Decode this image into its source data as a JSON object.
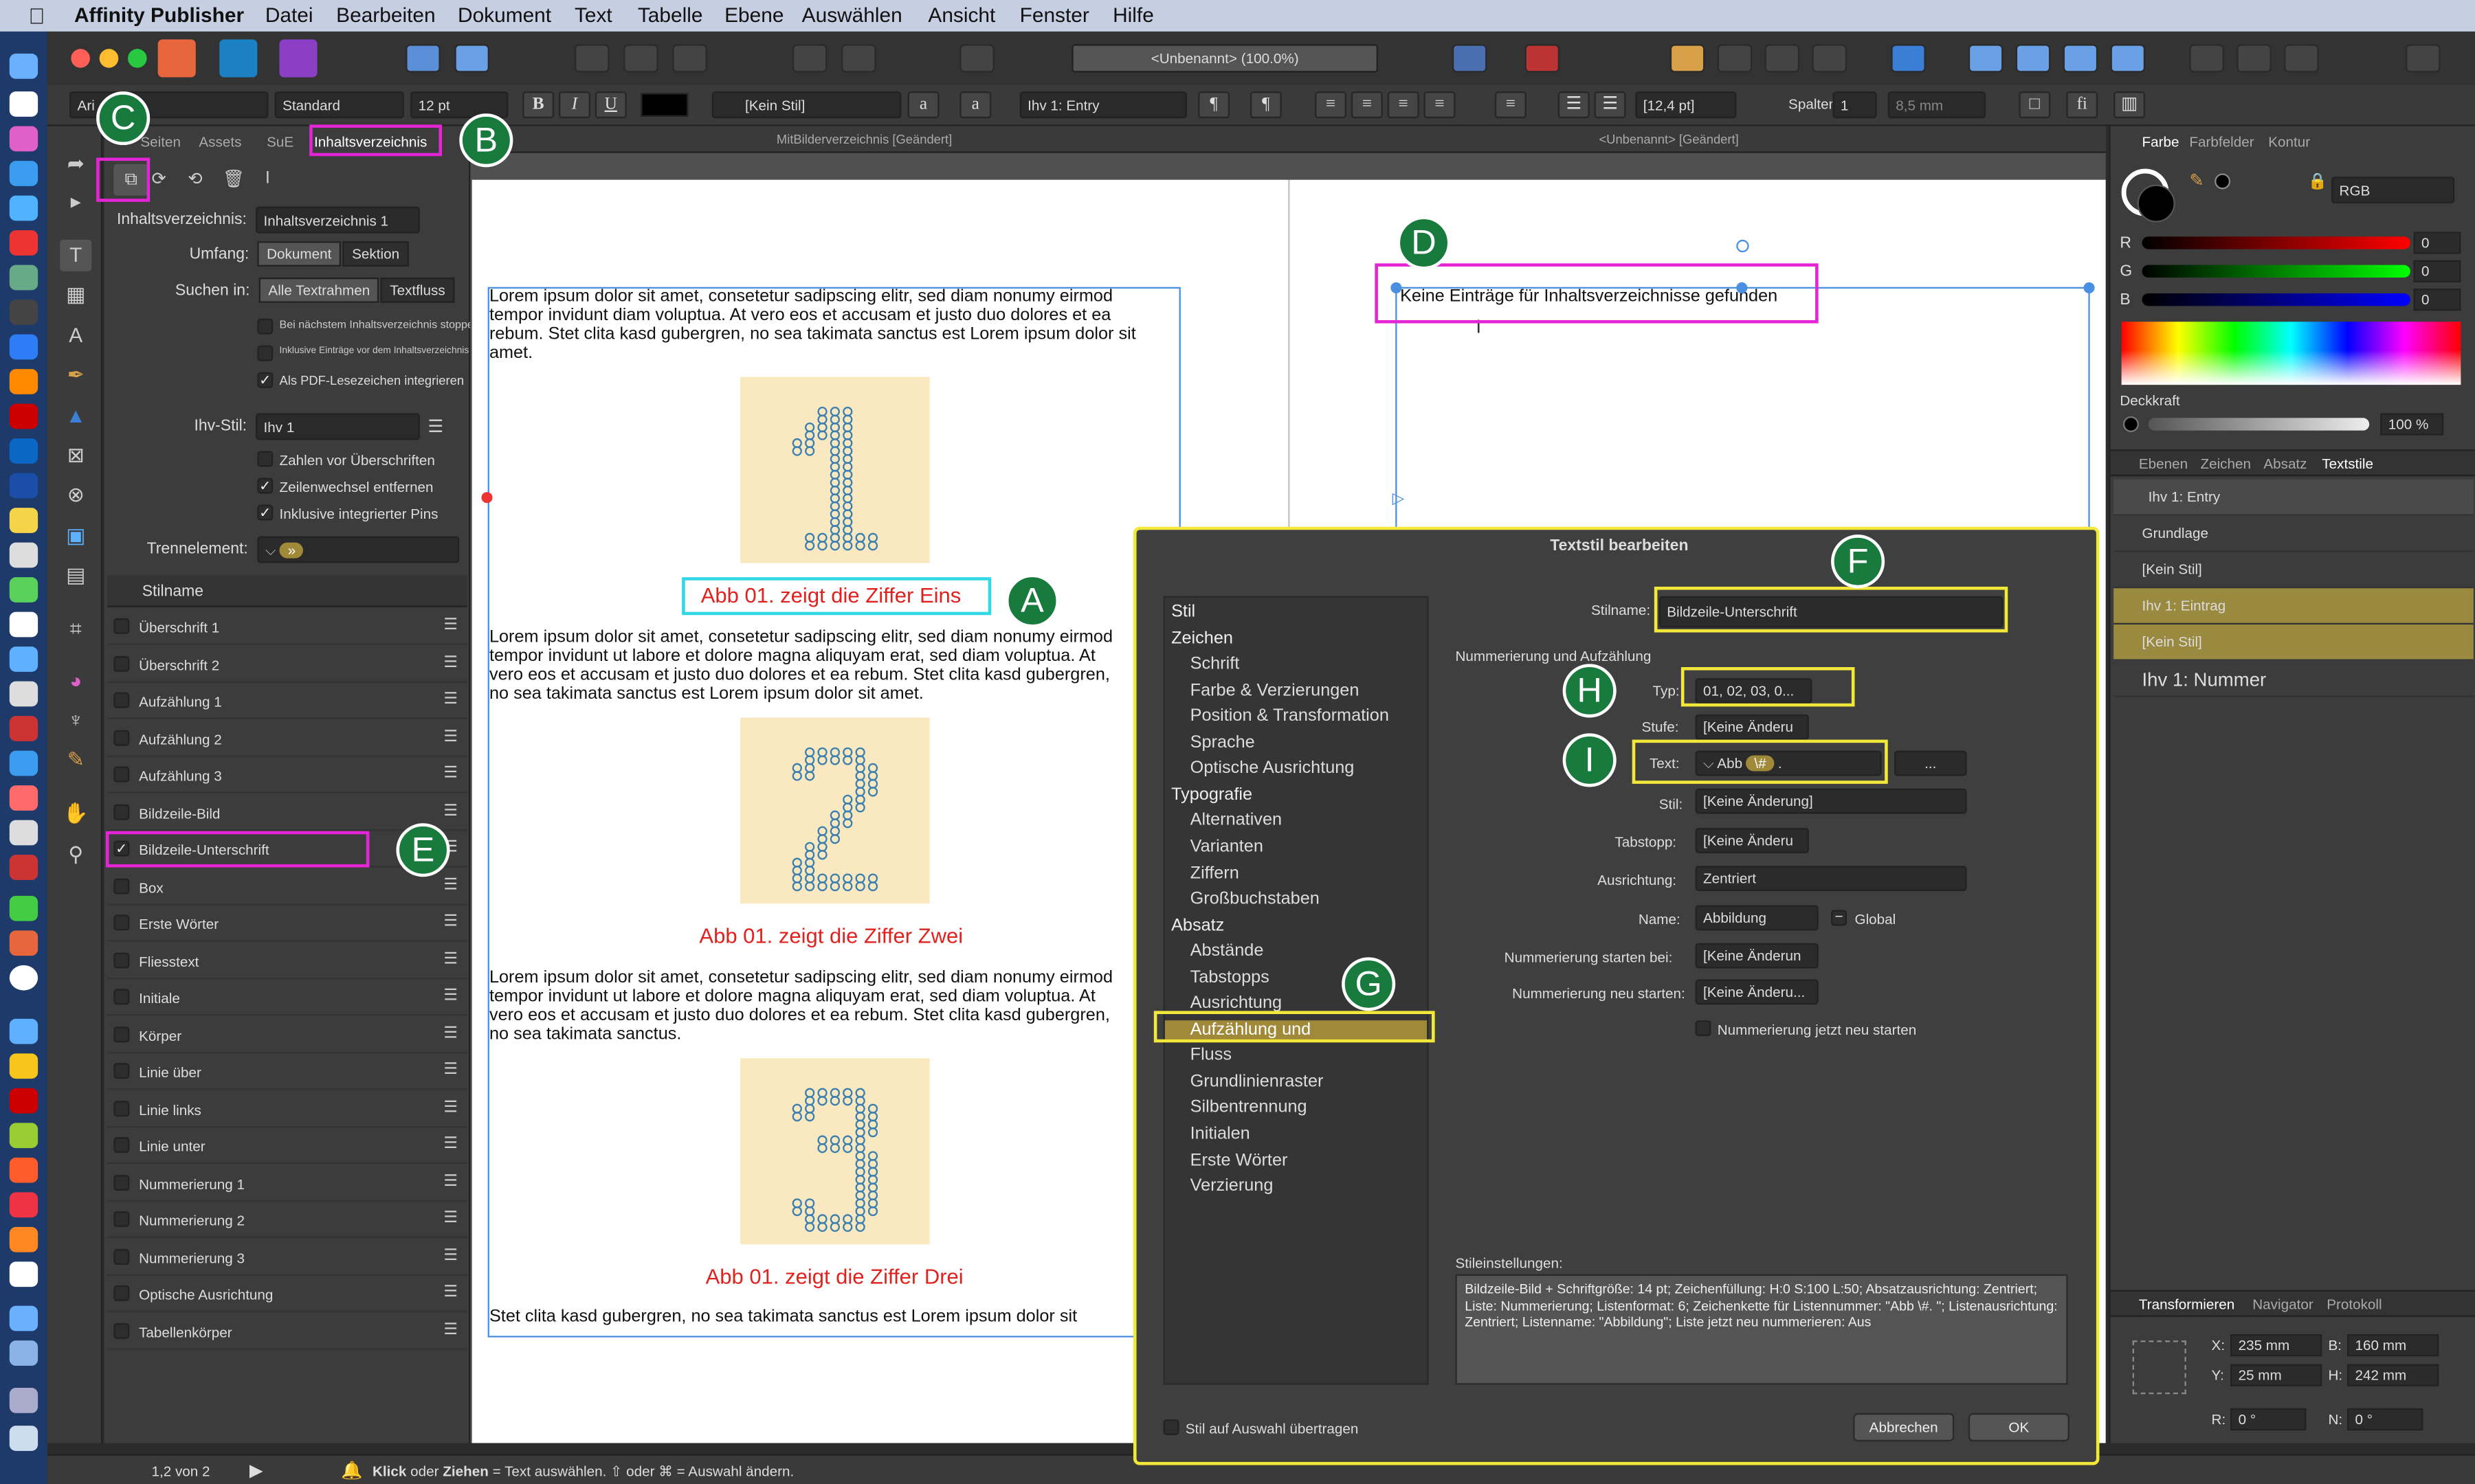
{
  "menubar": {
    "app": "Affinity Publisher",
    "items": [
      "Datei",
      "Bearbeiten",
      "Dokument",
      "Text",
      "Tabelle",
      "Ebene",
      "Auswählen",
      "Ansicht",
      "Fenster",
      "Hilfe"
    ]
  },
  "titlebar": {
    "doc_title": "<Unbenannt> (100.0%)"
  },
  "context_toolbar": {
    "font": "Ari",
    "style": "Standard",
    "size": "12 pt",
    "char_style": "[Kein Stil]",
    "para_style": "Ihv 1: Entry",
    "leading": "[12,4 pt]",
    "columns_label": "Spalten:",
    "columns": "1",
    "gutter": "8,5 mm",
    "bold": "B",
    "italic": "I",
    "underline": "U"
  },
  "left_panel": {
    "tabs": [
      "Seiten",
      "Assets",
      "SuE",
      "Inhaltsverzeichnis"
    ],
    "toc_label": "Inhaltsverzeichnis:",
    "toc_value": "Inhaltsverzeichnis 1",
    "scope_label": "Umfang:",
    "scope_options": [
      "Dokument",
      "Sektion"
    ],
    "search_label": "Suchen in:",
    "search_options": [
      "Alle Textrahmen",
      "Textfluss"
    ],
    "opt1": "Bei nächstem Inhaltsverzeichnis stoppen",
    "opt2": "Inklusive Einträge vor dem Inhaltsverzeichnis",
    "opt3": "Als PDF-Lesezeichen integrieren",
    "ihv_label": "Ihv-Stil:",
    "ihv_value": "Ihv 1",
    "opt4": "Zahlen vor Überschriften",
    "opt5": "Zeilenwechsel entfernen",
    "opt6": "Inklusive integrierter Pins",
    "sep_label": "Trennelement:",
    "sep_value": "»",
    "list_header": "Stilname",
    "styles": [
      "Überschrift 1",
      "Überschrift 2",
      "Aufzählung 1",
      "Aufzählung 2",
      "Aufzählung 3",
      "Bildzeile-Bild",
      "Bildzeile-Unterschrift",
      "Box",
      "Erste Wörter",
      "Fliesstext",
      "Initiale",
      "Körper",
      "Linie über",
      "Linie links",
      "Linie unter",
      "Nummerierung 1",
      "Nummerierung 2",
      "Nummerierung 3",
      "Optische Ausrichtung",
      "Tabellenkörper"
    ]
  },
  "canvas": {
    "tab1": "MitBilderverzeichnis [Geändert]",
    "tab2": "<Unbenannt> [Geändert]",
    "lorem1": "Lorem ipsum dolor sit amet, consetetur sadipscing elitr, sed diam nonumy eirmod tempor invidunt  diam voluptua. At vero eos et accusam et justo duo dolores et ea rebum. Stet clita kasd gubergren, no sea takimata sanctus est Lorem ipsum dolor sit amet.",
    "lorem2": "Lorem ipsum dolor sit amet, consetetur sadipscing elitr, sed diam nonumy eirmod tempor invidunt ut labore et dolore magna aliquyam erat, sed diam voluptua. At vero eos et accusam et justo duo dolores et ea rebum. Stet clita kasd gubergren, no sea takimata sanctus est Lorem ipsum dolor sit amet.",
    "lorem3": "Lorem ipsum dolor sit amet, consetetur sadipscing elitr, sed diam nonumy eirmod tempor invidunt ut labore et dolore magna aliquyam erat, sed diam voluptua. At vero eos et accusam et justo duo dolores et ea rebum. Stet clita kasd gubergren, no sea takimata sanctus.",
    "lorem4": "Stet clita kasd gubergren, no sea takimata sanctus est Lorem ipsum dolor sit",
    "caption1": "Abb 01. zeigt die Ziffer Eins",
    "caption2": "Abb 01. zeigt die Ziffer Zwei",
    "caption3": "Abb 01. zeigt die Ziffer Drei",
    "toc_text": "Keine Einträge für Inhaltsverzeichnisse gefunden"
  },
  "dialog": {
    "title": "Textstil bearbeiten",
    "categories": [
      {
        "label": "Stil",
        "sub": false
      },
      {
        "label": "Zeichen",
        "sub": false
      },
      {
        "label": "Schrift",
        "sub": true
      },
      {
        "label": "Farbe & Verzierungen",
        "sub": true
      },
      {
        "label": "Position & Transformation",
        "sub": true
      },
      {
        "label": "Sprache",
        "sub": true
      },
      {
        "label": "Optische Ausrichtung",
        "sub": true
      },
      {
        "label": "Typografie",
        "sub": false
      },
      {
        "label": "Alternativen",
        "sub": true
      },
      {
        "label": "Varianten",
        "sub": true
      },
      {
        "label": "Ziffern",
        "sub": true
      },
      {
        "label": "Großbuchstaben",
        "sub": true
      },
      {
        "label": "Absatz",
        "sub": false
      },
      {
        "label": "Abstände",
        "sub": true
      },
      {
        "label": "Tabstopps",
        "sub": true
      },
      {
        "label": "Ausrichtung",
        "sub": true
      },
      {
        "label": "Aufzählung und",
        "sub": true
      },
      {
        "label": "Fluss",
        "sub": true
      },
      {
        "label": "Grundlinienraster",
        "sub": true
      },
      {
        "label": "Silbentrennung",
        "sub": true
      },
      {
        "label": "Initialen",
        "sub": true
      },
      {
        "label": "Erste Wörter",
        "sub": true
      },
      {
        "label": "Verzierung",
        "sub": true
      }
    ],
    "stylename_label": "Stilname:",
    "stylename": "Bildzeile-Unterschrift",
    "section": "Nummerierung und Aufzählung",
    "typ_label": "Typ:",
    "typ": "01, 02, 03, 0...",
    "stufe_label": "Stufe:",
    "stufe": "[Keine Änderu",
    "text_label": "Text:",
    "text_prefix": "Abb",
    "text_token": "\\#",
    "text_suffix": ".",
    "text_more": "...",
    "stil_label": "Stil:",
    "stil": "[Keine Änderung]",
    "tab_label": "Tabstopp:",
    "tab": "[Keine Änderu",
    "align_label": "Ausrichtung:",
    "align": "Zentriert",
    "name_label": "Name:",
    "name": "Abbildung",
    "global": "Global",
    "start_label": "Nummerierung starten bei:",
    "start": "[Keine Änderun",
    "restart_label": "Nummerierung neu starten:",
    "restart": "[Keine Änderu...",
    "restart_now": "Nummerierung jetzt neu starten",
    "settings_label": "Stileinstellungen:",
    "settings": "Bildzeile-Bild + Schriftgröße: 14 pt; Zeichenfüllung: H:0 S:100 L:50; Absatzausrichtung: Zentriert; Liste: Nummerierung; Listenformat: 6; Zeichenkette für Listennummer: \"Abb \\#. \"; Listenausrichtung: Zentriert; Listenname: \"Abbildung\"; Liste jetzt neu nummerieren: Aus",
    "apply": "Stil auf Auswahl übertragen",
    "cancel": "Abbrechen",
    "ok": "OK"
  },
  "right_panel": {
    "color_tabs": [
      "Farbe",
      "Farbfelder",
      "Kontur"
    ],
    "color_model": "RGB",
    "r_label": "R",
    "r": "0",
    "g_label": "G",
    "g": "0",
    "b_label": "B",
    "b": "0",
    "opacity_label": "Deckkraft",
    "opacity": "100 %",
    "style_tabs": [
      "Ebenen",
      "Zeichen",
      "Absatz",
      "Textstile"
    ],
    "styles": [
      "Ihv 1: Entry",
      "Grundlage",
      "[Kein Stil]",
      "Ihv 1: Eintrag",
      "[Kein Stil]",
      "Ihv 1: Nummer"
    ],
    "transform_tabs": [
      "Transformieren",
      "Navigator",
      "Protokoll"
    ],
    "x_label": "X:",
    "x": "235 mm",
    "y_label": "Y:",
    "y": "25 mm",
    "w_label": "B:",
    "w": "160 mm",
    "h_label": "H:",
    "h": "242 mm",
    "r_label2": "R:",
    "rot": "0 °",
    "n_label": "N:",
    "shear": "0 °"
  },
  "statusbar": {
    "page": "1,2 von 2",
    "hint_b1": "Klick",
    "hint1": " oder ",
    "hint_b2": "Ziehen",
    "hint2": " = Text auswählen. ⇧ oder ⌘ = Auswahl ändern."
  },
  "markers": {
    "a": "A",
    "b": "B",
    "c": "C",
    "d": "D",
    "e": "E",
    "f": "F",
    "g": "G",
    "h": "H",
    "i": "I"
  },
  "colors": {
    "marker": "#187a3c",
    "pink": "#e425d6",
    "yellow": "#f2e83a",
    "cyan": "#33d8e6",
    "caption": "#e0211e",
    "figure_bg": "#fae9c0"
  }
}
